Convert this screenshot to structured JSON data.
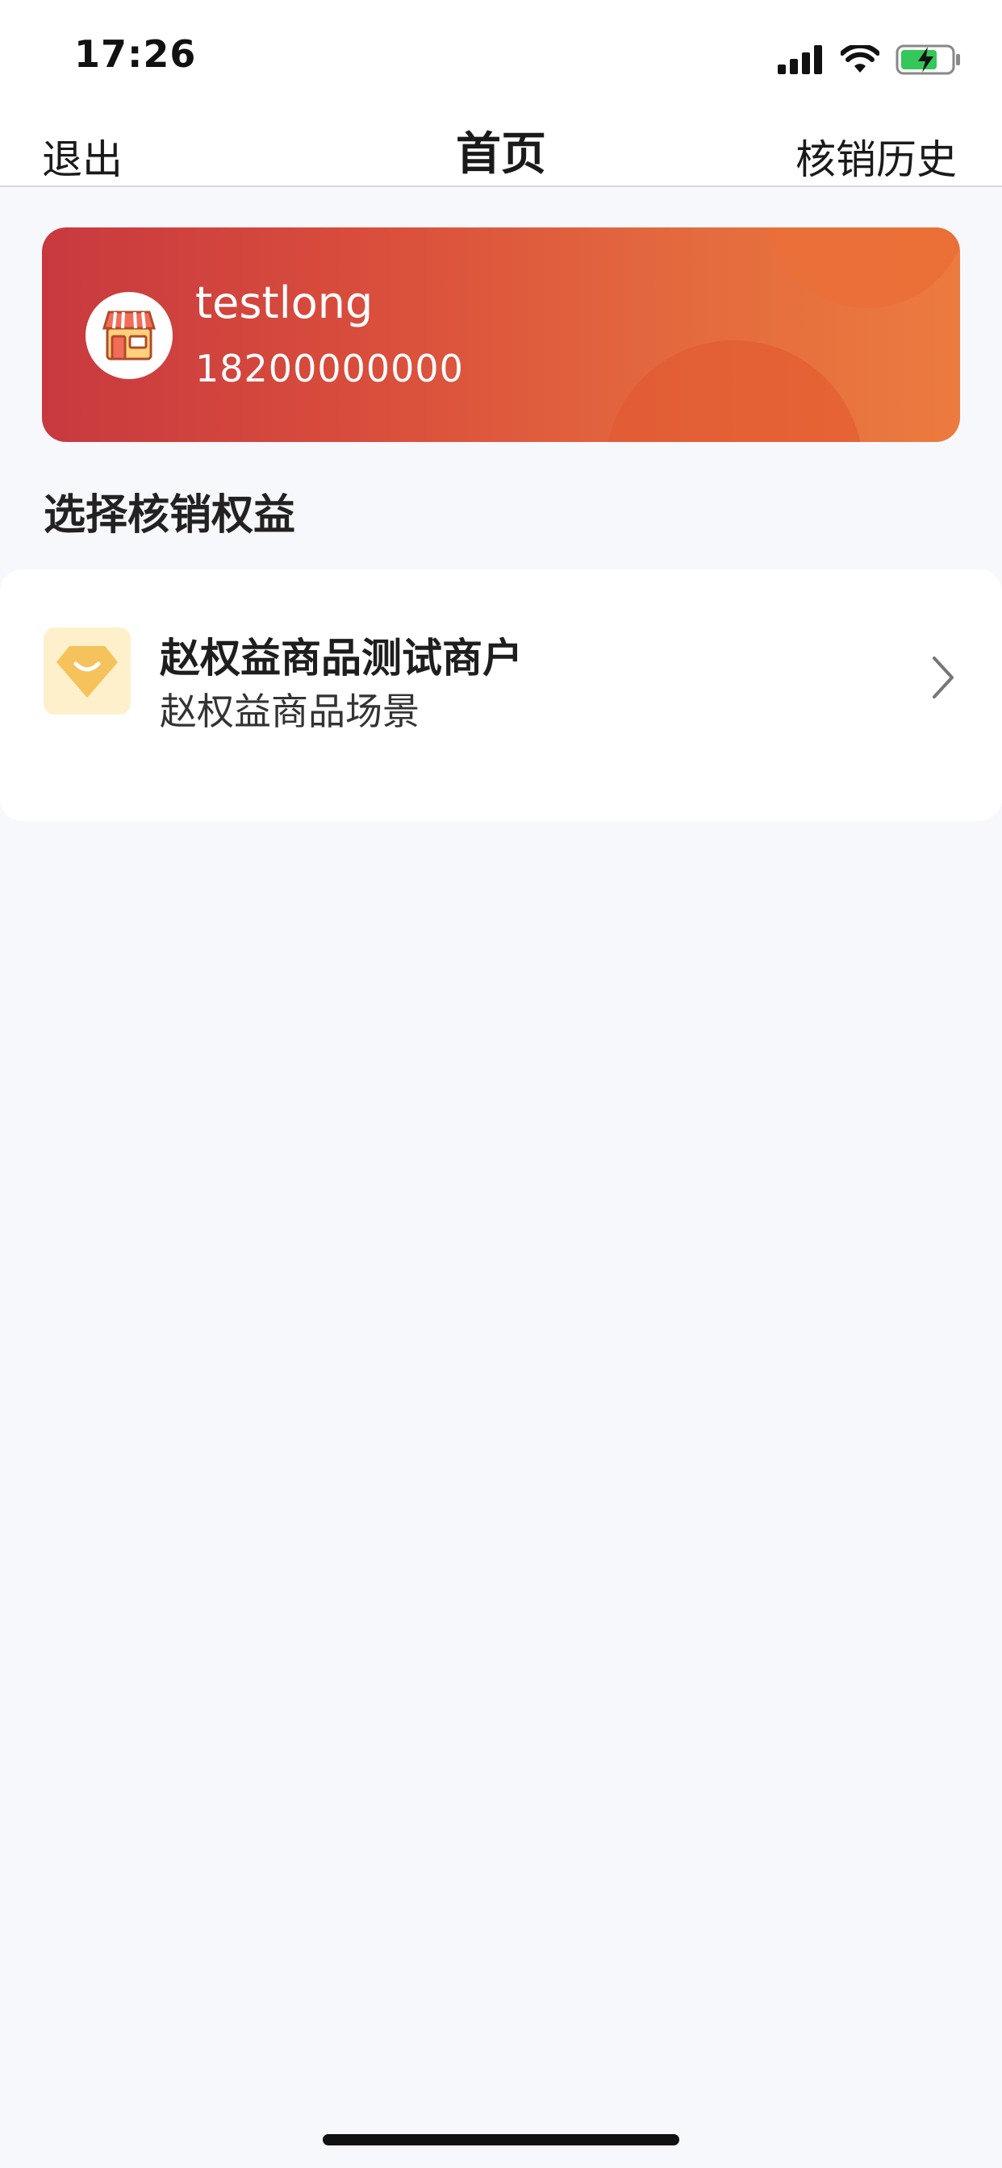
{
  "status_bar": {
    "time": "17:26",
    "icons": [
      "signal-icon",
      "wifi-icon",
      "battery-charging-icon"
    ]
  },
  "nav": {
    "left_label": "退出",
    "title": "首页",
    "right_label": "核销历史"
  },
  "merchant": {
    "name": "testlong",
    "phone": "18200000000",
    "avatar_icon": "store-icon"
  },
  "section": {
    "title": "选择核销权益"
  },
  "benefits": [
    {
      "title": "赵权益商品测试商户",
      "subtitle": "赵权益商品场景",
      "icon": "gem-icon"
    }
  ],
  "colors": {
    "card_gradient_start": "#c8393f",
    "card_gradient_end": "#ec7b3f",
    "page_background": "#f7f8fc",
    "benefit_icon_bg": "#fff0cc",
    "gem_color": "#f6c25c"
  }
}
